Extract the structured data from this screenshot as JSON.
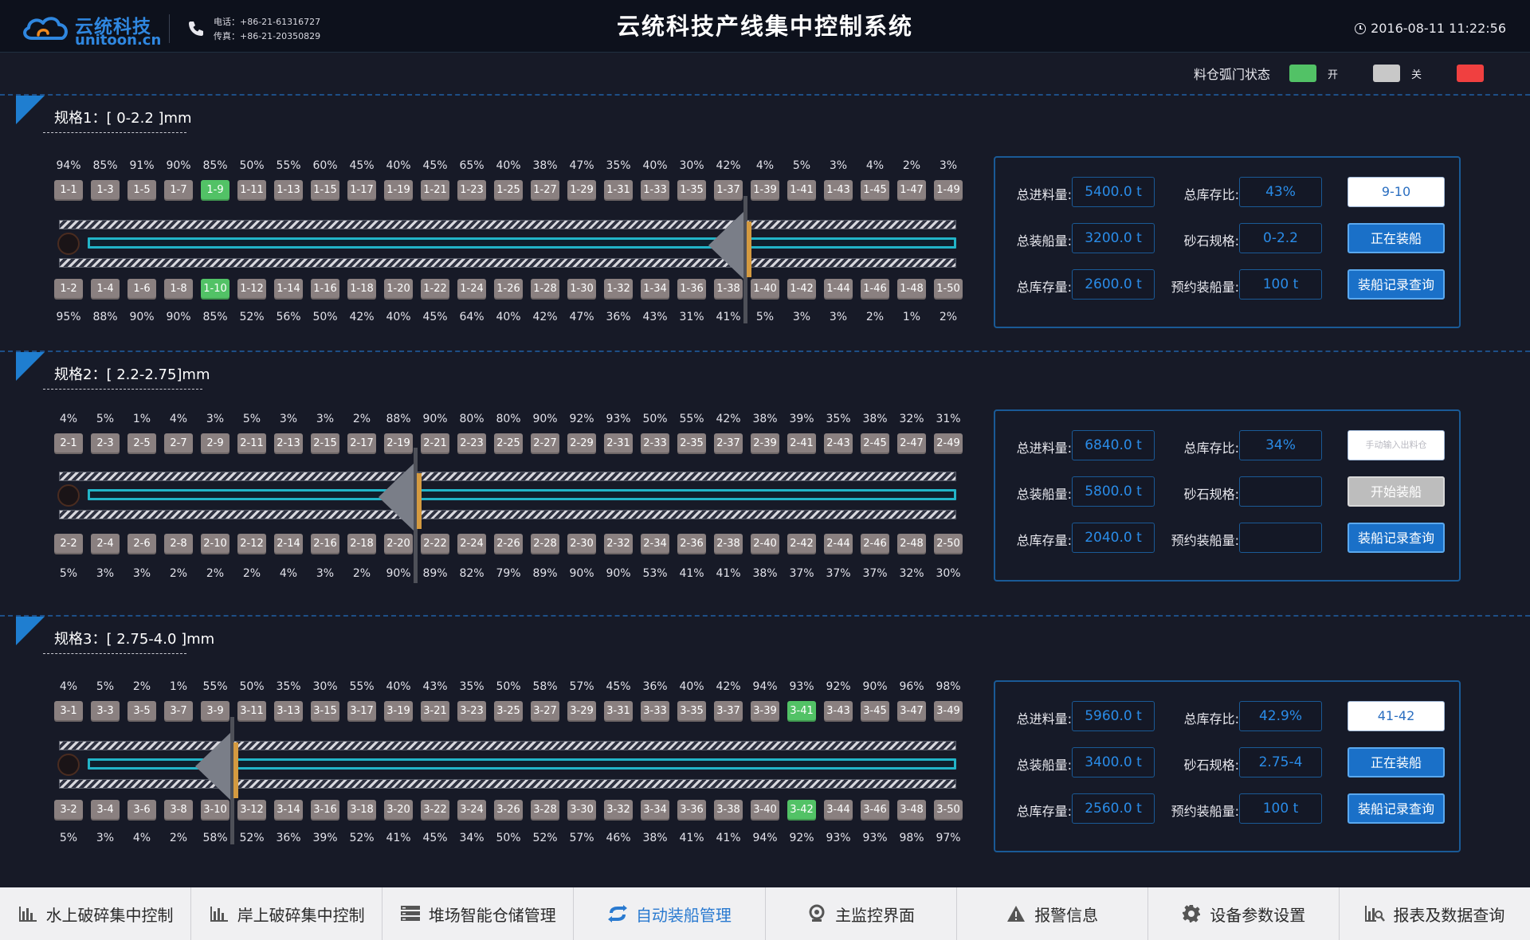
{
  "header": {
    "logo_text": "云统科技",
    "logo_sub": "unitoon.cn",
    "phone": "电话：+86-21-61316727",
    "fax": "传真：+86-21-20350829",
    "title": "云统科技产线集中控制系统",
    "datetime": "2016-08-11  11:22:56"
  },
  "legend": {
    "label": "料仓弧门状态",
    "open_label": "开",
    "closed_label": "关",
    "open_color": "#52c266",
    "closed_color": "#c8c8c8",
    "fault_color": "#f04040"
  },
  "sections": [
    {
      "title": "规格1：[ 0-2.2 ]mm",
      "top_pct": [
        "94%",
        "85%",
        "91%",
        "90%",
        "85%",
        "50%",
        "55%",
        "60%",
        "45%",
        "40%",
        "45%",
        "65%",
        "40%",
        "38%",
        "47%",
        "35%",
        "40%",
        "30%",
        "42%",
        "4%",
        "5%",
        "3%",
        "4%",
        "2%",
        "3%"
      ],
      "top_bins": [
        "1-1",
        "1-3",
        "1-5",
        "1-7",
        "1-9",
        "1-11",
        "1-13",
        "1-15",
        "1-17",
        "1-19",
        "1-21",
        "1-23",
        "1-25",
        "1-27",
        "1-29",
        "1-31",
        "1-33",
        "1-35",
        "1-37",
        "1-39",
        "1-41",
        "1-43",
        "1-45",
        "1-47",
        "1-49"
      ],
      "bottom_bins": [
        "1-2",
        "1-4",
        "1-6",
        "1-8",
        "1-10",
        "1-12",
        "1-14",
        "1-16",
        "1-18",
        "1-20",
        "1-22",
        "1-24",
        "1-26",
        "1-28",
        "1-30",
        "1-32",
        "1-34",
        "1-36",
        "1-38",
        "1-40",
        "1-42",
        "1-44",
        "1-46",
        "1-48",
        "1-50"
      ],
      "bottom_pct": [
        "95%",
        "88%",
        "90%",
        "90%",
        "85%",
        "52%",
        "56%",
        "50%",
        "42%",
        "40%",
        "45%",
        "64%",
        "40%",
        "42%",
        "47%",
        "36%",
        "43%",
        "31%",
        "41%",
        "5%",
        "3%",
        "3%",
        "2%",
        "1%",
        "2%"
      ],
      "open_top": [
        4
      ],
      "open_bottom": [
        4
      ],
      "carrier_position": 18.5,
      "panel": {
        "l1": "总进料量:",
        "v1": "5400.0 t",
        "l2": "总装船量:",
        "v2": "3200.0 t",
        "l3": "总库存量:",
        "v3": "2600.0 t",
        "l4": "总库存比:",
        "v4": "43%",
        "l5": "砂石规格:",
        "v5": "0-2.2",
        "l6": "预约装船量:",
        "v6": "100 t",
        "b1": "9-10",
        "b1_style": "white",
        "b2": "正在装船",
        "b2_style": "blue",
        "b3": "装船记录查询",
        "b3_style": "blue"
      }
    },
    {
      "title": "规格2：[ 2.2-2.75]mm",
      "top_pct": [
        "4%",
        "5%",
        "1%",
        "4%",
        "3%",
        "5%",
        "3%",
        "3%",
        "2%",
        "88%",
        "90%",
        "80%",
        "80%",
        "90%",
        "92%",
        "93%",
        "50%",
        "55%",
        "42%",
        "38%",
        "39%",
        "35%",
        "38%",
        "32%",
        "31%"
      ],
      "top_bins": [
        "2-1",
        "2-3",
        "2-5",
        "2-7",
        "2-9",
        "2-11",
        "2-13",
        "2-15",
        "2-17",
        "2-19",
        "2-21",
        "2-23",
        "2-25",
        "2-27",
        "2-29",
        "2-31",
        "2-33",
        "2-35",
        "2-37",
        "2-39",
        "2-41",
        "2-43",
        "2-45",
        "2-47",
        "2-49"
      ],
      "bottom_bins": [
        "2-2",
        "2-4",
        "2-6",
        "2-8",
        "2-10",
        "2-12",
        "2-14",
        "2-16",
        "2-18",
        "2-20",
        "2-22",
        "2-24",
        "2-26",
        "2-28",
        "2-30",
        "2-32",
        "2-34",
        "2-36",
        "2-38",
        "2-40",
        "2-42",
        "2-44",
        "2-46",
        "2-48",
        "2-50"
      ],
      "bottom_pct": [
        "5%",
        "3%",
        "3%",
        "2%",
        "2%",
        "2%",
        "4%",
        "3%",
        "2%",
        "90%",
        "89%",
        "82%",
        "79%",
        "89%",
        "90%",
        "90%",
        "53%",
        "41%",
        "41%",
        "38%",
        "37%",
        "37%",
        "37%",
        "32%",
        "30%"
      ],
      "open_top": [],
      "open_bottom": [],
      "carrier_position": 9.5,
      "panel": {
        "l1": "总进料量:",
        "v1": "6840.0 t",
        "l2": "总装船量:",
        "v2": "5800.0 t",
        "l3": "总库存量:",
        "v3": "2040.0 t",
        "l4": "总库存比:",
        "v4": "34%",
        "l5": "砂石规格:",
        "v5": "",
        "l6": "预约装船量:",
        "v6": "",
        "b1": "手动输入出料仓",
        "b1_style": "input",
        "b2": "开始装船",
        "b2_style": "gray",
        "b3": "装船记录查询",
        "b3_style": "blue"
      }
    },
    {
      "title": "规格3：[ 2.75-4.0 ]mm",
      "top_pct": [
        "4%",
        "5%",
        "2%",
        "1%",
        "55%",
        "50%",
        "35%",
        "30%",
        "55%",
        "40%",
        "43%",
        "35%",
        "50%",
        "58%",
        "57%",
        "45%",
        "36%",
        "40%",
        "42%",
        "94%",
        "93%",
        "92%",
        "90%",
        "96%",
        "98%"
      ],
      "top_bins": [
        "3-1",
        "3-3",
        "3-5",
        "3-7",
        "3-9",
        "3-11",
        "3-13",
        "3-15",
        "3-17",
        "3-19",
        "3-21",
        "3-23",
        "3-25",
        "3-27",
        "3-29",
        "3-31",
        "3-33",
        "3-35",
        "3-37",
        "3-39",
        "3-41",
        "3-43",
        "3-45",
        "3-47",
        "3-49"
      ],
      "bottom_bins": [
        "3-2",
        "3-4",
        "3-6",
        "3-8",
        "3-10",
        "3-12",
        "3-14",
        "3-16",
        "3-18",
        "3-20",
        "3-22",
        "3-24",
        "3-26",
        "3-28",
        "3-30",
        "3-32",
        "3-34",
        "3-36",
        "3-38",
        "3-40",
        "3-42",
        "3-44",
        "3-46",
        "3-48",
        "3-50"
      ],
      "bottom_pct": [
        "5%",
        "3%",
        "4%",
        "2%",
        "58%",
        "52%",
        "36%",
        "39%",
        "52%",
        "41%",
        "45%",
        "34%",
        "50%",
        "52%",
        "57%",
        "46%",
        "38%",
        "41%",
        "41%",
        "94%",
        "92%",
        "93%",
        "93%",
        "98%",
        "97%"
      ],
      "open_top": [
        20
      ],
      "open_bottom": [
        20
      ],
      "carrier_position": 4.5,
      "panel": {
        "l1": "总进料量:",
        "v1": "5960.0 t",
        "l2": "总装船量:",
        "v2": "3400.0 t",
        "l3": "总库存量:",
        "v3": "2560.0 t",
        "l4": "总库存比:",
        "v4": "42.9%",
        "l5": "砂石规格:",
        "v5": "2.75-4",
        "l6": "预约装船量:",
        "v6": "100 t",
        "b1": "41-42",
        "b1_style": "white",
        "b2": "正在装船",
        "b2_style": "blue",
        "b3": "装船记录查询",
        "b3_style": "blue"
      }
    }
  ],
  "nav": [
    {
      "label": "水上破碎集中控制",
      "icon": "bar-chart-icon"
    },
    {
      "label": "岸上破碎集中控制",
      "icon": "bar-chart-icon"
    },
    {
      "label": "堆场智能仓储管理",
      "icon": "storage-icon"
    },
    {
      "label": "自动装船管理",
      "icon": "refresh-icon",
      "active": true
    },
    {
      "label": "主监控界面",
      "icon": "monitor-icon"
    },
    {
      "label": "报警信息",
      "icon": "warning-icon"
    },
    {
      "label": "设备参数设置",
      "icon": "gear-icon"
    },
    {
      "label": "报表及数据查询",
      "icon": "report-search-icon"
    }
  ]
}
